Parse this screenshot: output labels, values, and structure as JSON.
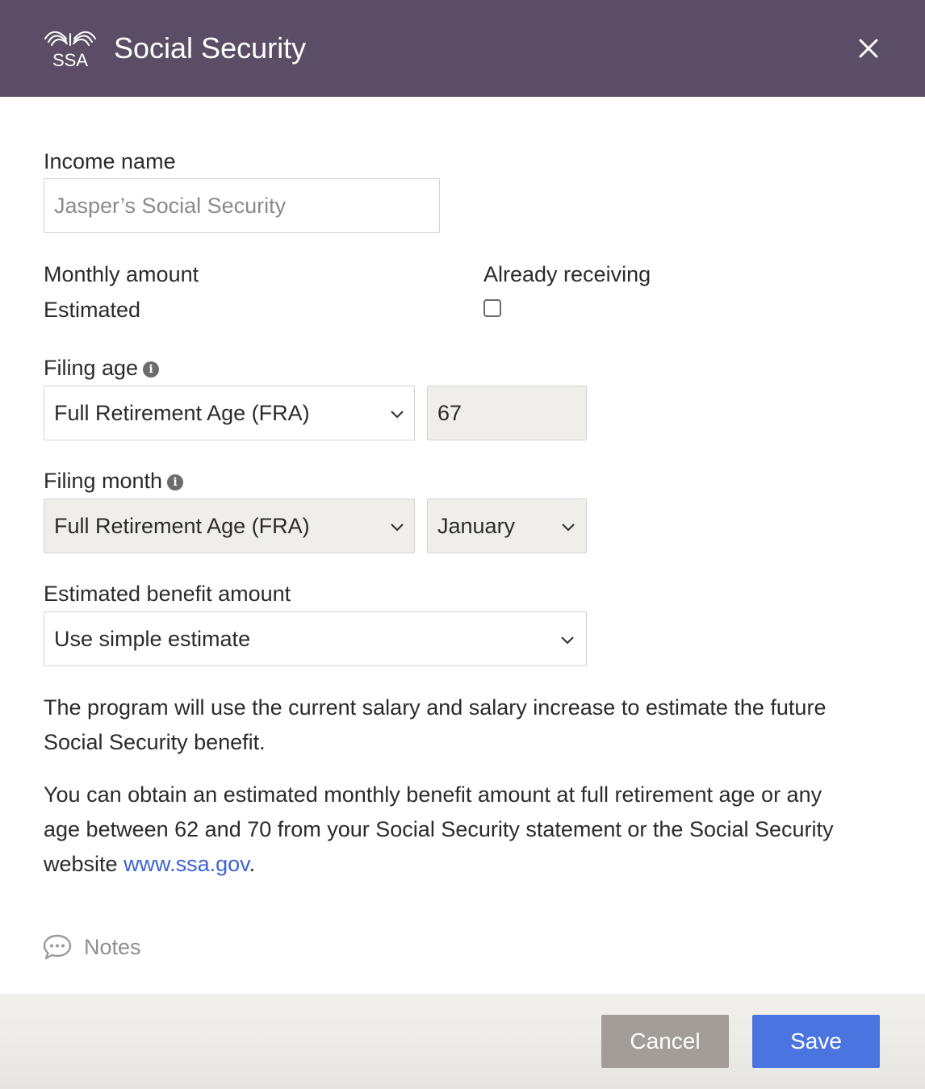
{
  "header": {
    "logo_text": "SSA",
    "title": "Social Security",
    "close_icon": "close-icon"
  },
  "form": {
    "income_name": {
      "label": "Income name",
      "placeholder": "Jasper’s Social Security"
    },
    "monthly_amount": {
      "label": "Monthly amount",
      "value": "Estimated"
    },
    "already_receiving": {
      "label": "Already receiving",
      "checked": false
    },
    "filing_age": {
      "label": "Filing age",
      "selected": "Full Retirement Age (FRA)",
      "age": "67"
    },
    "filing_month": {
      "label": "Filing month",
      "selected": "Full Retirement Age (FRA)",
      "month": "January"
    },
    "estimated_benefit": {
      "label": "Estimated benefit amount",
      "selected": "Use simple estimate"
    }
  },
  "info": {
    "paragraph1": "The program will use the current salary and salary increase to estimate the future Social Security benefit.",
    "paragraph2_prefix": "You can obtain an estimated monthly benefit amount at full retirement age or any age between 62 and 70 from your Social Security statement or the Social Security website ",
    "link": "www.ssa.gov",
    "paragraph2_suffix": "."
  },
  "notes": {
    "label": "Notes"
  },
  "footer": {
    "cancel_label": "Cancel",
    "save_label": "Save"
  },
  "colors": {
    "header_bg": "#5c4d66",
    "primary": "#4a74e0",
    "cancel": "#a39d99",
    "link": "#3e62d6"
  }
}
